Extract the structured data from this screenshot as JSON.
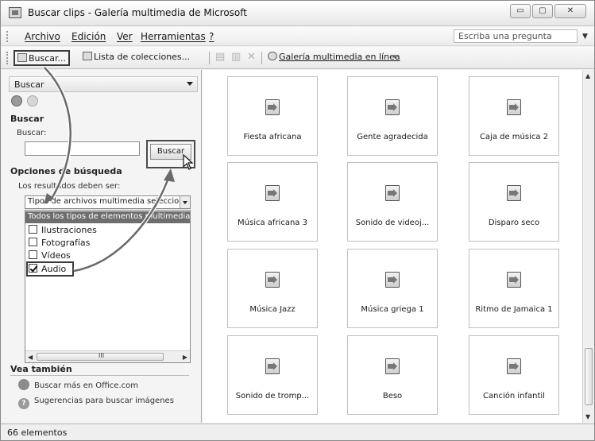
{
  "window": {
    "title": "Buscar clips - Galería multimedia de Microsoft",
    "buttons": {
      "minimize": "▭",
      "maximize": "▢",
      "close": "✕"
    }
  },
  "menu": {
    "items": [
      "Archivo",
      "Edición",
      "Ver",
      "Herramientas",
      "?"
    ],
    "ask_placeholder": "Escriba una pregunta"
  },
  "toolbar": {
    "buscar": "Buscar...",
    "lista_colecciones": "Lista de colecciones...",
    "galeria_linea": "Galería multimedia en línea"
  },
  "pane": {
    "header": "Buscar",
    "section_buscar": "Buscar",
    "buscar_label": "Buscar:",
    "search_value": "",
    "buscar_button": "Buscar",
    "section_opciones": "Opciones de búsqueda",
    "results_label": "Los resultados deben ser:",
    "results_select": "Tipos de archivos multimedia seleccionados",
    "list_selected": "Todos los tipos de elementos multimedia",
    "media_types": [
      {
        "label": "Ilustraciones",
        "checked": false
      },
      {
        "label": "Fotografías",
        "checked": false
      },
      {
        "label": "Vídeos",
        "checked": false
      },
      {
        "label": "Audio",
        "checked": true
      }
    ],
    "section_vea": "Vea también",
    "link_office": "Buscar más en Office.com",
    "link_sugerencias": "Sugerencias para buscar imágenes",
    "scroll_mark": "III"
  },
  "gallery": {
    "clips": [
      "Fiesta africana",
      "Gente agradecida",
      "Caja de música 2",
      "Música africana 3",
      "Sonido de videoj...",
      "Disparo seco",
      "Música Jazz",
      "Música griega 1",
      "Ritmo de Jamaica 1",
      "Sonido de tromp...",
      "Beso",
      "Canción infantil"
    ]
  },
  "status": {
    "text": "66 elementos"
  },
  "icons": [
    "app-icon",
    "search-icon",
    "collections-icon",
    "delete-icon",
    "web-gallery-icon",
    "back-icon",
    "forward-icon",
    "sound-clip-icon",
    "office-link-icon",
    "help-icon",
    "cursor-icon"
  ]
}
